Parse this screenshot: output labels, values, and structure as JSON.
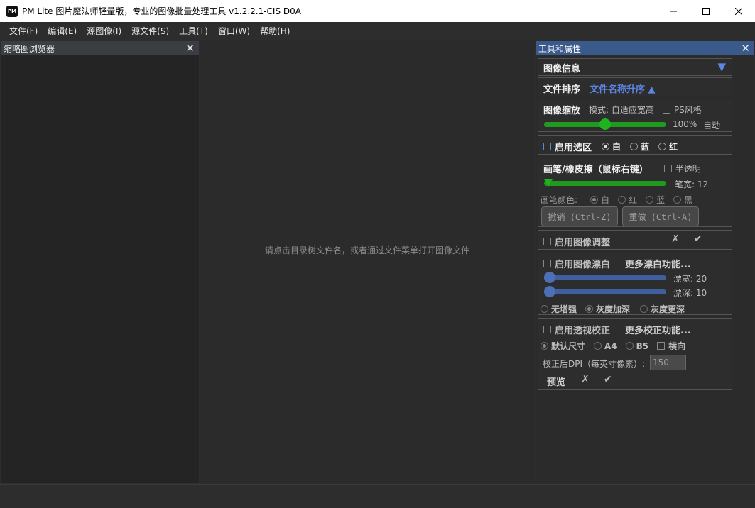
{
  "window": {
    "logo_text": "PM",
    "title": "PM Lite 图片魔法师轻量版，专业的图像批量处理工具 v1.2.2.1-CIS D0A"
  },
  "menu": [
    "文件(F)",
    "编辑(E)",
    "源图像(I)",
    "源文件(S)",
    "工具(T)",
    "窗口(W)",
    "帮助(H)"
  ],
  "thumbnail_panel": {
    "title": "缩略图浏览器",
    "close": "✕"
  },
  "center": {
    "hint": "请点击目录树文件名，或者通过文件菜单打开图像文件"
  },
  "tools_panel": {
    "title": "工具和属性",
    "close": "✕",
    "image_info": {
      "label": "图像信息",
      "expand_icon": "▼"
    },
    "file_sort": {
      "label": "文件排序",
      "value": "文件名称升序 ▲"
    },
    "zoom": {
      "label": "图像缩放",
      "mode": "模式: 自适应宽高",
      "ps_style": "PS风格",
      "percent": "100%",
      "auto": "自动",
      "level": 0.5
    },
    "selection": {
      "label": "启用选区",
      "options": [
        "白",
        "蓝",
        "红"
      ],
      "selected": "白"
    },
    "brush": {
      "label": "画笔/橡皮擦（鼠标右键）",
      "translucent": "半透明",
      "width_text": "笔宽: 12",
      "color_label": "画笔颜色:",
      "colors": [
        "白",
        "红",
        "蓝",
        "黑"
      ],
      "selected_color": "白",
      "undo": "撤销 (Ctrl-Z)",
      "redo": "重做 (Ctrl-A)",
      "width_level": 0.02
    },
    "adjust": {
      "label": "启用图像调整",
      "cancel": "✗",
      "ok": "✔"
    },
    "whiten": {
      "label": "启用图像漂白",
      "more": "更多漂白功能...",
      "width_text": "漂宽: 20",
      "depth_text": "漂深: 10",
      "options": [
        "无增强",
        "灰度加深",
        "灰度更深"
      ],
      "selected": "灰度加深",
      "width_level": 0.02,
      "depth_level": 0.02
    },
    "perspective": {
      "label": "启用透视校正",
      "more": "更多校正功能...",
      "sizes": [
        "默认尺寸",
        "A4",
        "B5"
      ],
      "selected": "默认尺寸",
      "landscape": "横向",
      "dpi_label": "校正后DPI（每英寸像素）:",
      "dpi_value": "150",
      "preview": "预览",
      "cancel": "✗",
      "ok": "✔"
    }
  },
  "colors": {
    "accent_blue": "#5b86e5",
    "slider_green": "#1f9a1f",
    "slider_blue": "#3f5f9e",
    "header_blue": "#3a5a8c"
  }
}
